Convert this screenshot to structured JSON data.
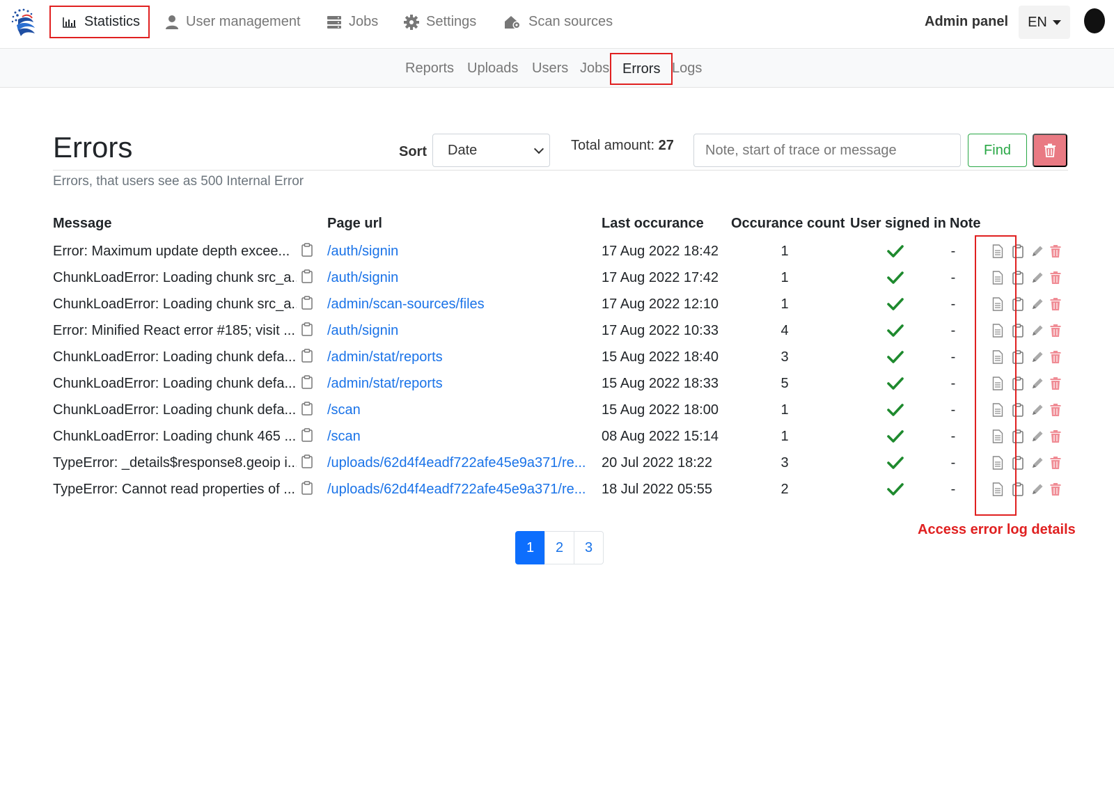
{
  "topnav": {
    "items": [
      {
        "label": "Statistics",
        "icon": "bar-chart-icon",
        "active": true
      },
      {
        "label": "User management",
        "icon": "user-icon"
      },
      {
        "label": "Jobs",
        "icon": "server-icon"
      },
      {
        "label": "Settings",
        "icon": "gear-icon"
      },
      {
        "label": "Scan sources",
        "icon": "house-gear-icon"
      }
    ],
    "admin_label": "Admin panel",
    "language": "EN"
  },
  "subnav": {
    "items": [
      {
        "label": "Reports"
      },
      {
        "label": "Uploads"
      },
      {
        "label": "Users"
      },
      {
        "label": "Jobs"
      },
      {
        "label": "Errors",
        "active": true
      },
      {
        "label": "Logs"
      }
    ]
  },
  "page": {
    "title": "Errors",
    "subtitle": "Errors, that users see as 500 Internal Error",
    "sort_label": "Sort",
    "sort_value": "Date",
    "total_label": "Total amount:",
    "total_value": "27",
    "search_placeholder": "Note, start of trace or message",
    "find_label": "Find"
  },
  "table": {
    "headers": {
      "message": "Message",
      "page_url": "Page url",
      "last_occurance": "Last occurance",
      "occurance_count": "Occurance count",
      "user_signed_in": "User signed in",
      "note": "Note"
    },
    "rows": [
      {
        "message": "Error: Maximum update depth excee...",
        "url": "/auth/signin",
        "date": "17 Aug 2022 18:42",
        "count": "1",
        "signed_in": true,
        "note": "-"
      },
      {
        "message": "ChunkLoadError: Loading chunk src_a...",
        "url": "/auth/signin",
        "date": "17 Aug 2022 17:42",
        "count": "1",
        "signed_in": true,
        "note": "-"
      },
      {
        "message": "ChunkLoadError: Loading chunk src_a...",
        "url": "/admin/scan-sources/files",
        "date": "17 Aug 2022 12:10",
        "count": "1",
        "signed_in": true,
        "note": "-"
      },
      {
        "message": "Error: Minified React error #185; visit ...",
        "url": "/auth/signin",
        "date": "17 Aug 2022 10:33",
        "count": "4",
        "signed_in": true,
        "note": "-"
      },
      {
        "message": "ChunkLoadError: Loading chunk defa...",
        "url": "/admin/stat/reports",
        "date": "15 Aug 2022 18:40",
        "count": "3",
        "signed_in": true,
        "note": "-"
      },
      {
        "message": "ChunkLoadError: Loading chunk defa...",
        "url": "/admin/stat/reports",
        "date": "15 Aug 2022 18:33",
        "count": "5",
        "signed_in": true,
        "note": "-"
      },
      {
        "message": "ChunkLoadError: Loading chunk defa...",
        "url": "/scan",
        "date": "15 Aug 2022 18:00",
        "count": "1",
        "signed_in": true,
        "note": "-"
      },
      {
        "message": "ChunkLoadError: Loading chunk 465 ...",
        "url": "/scan",
        "date": "08 Aug 2022 15:14",
        "count": "1",
        "signed_in": true,
        "note": "-"
      },
      {
        "message": "TypeError: _details$response8.geoip i...",
        "url": "/uploads/62d4f4eadf722afe45e9a371/re...",
        "date": "20 Jul 2022 18:22",
        "count": "3",
        "signed_in": true,
        "note": "-"
      },
      {
        "message": "TypeError: Cannot read properties of ...",
        "url": "/uploads/62d4f4eadf722afe45e9a371/re...",
        "date": "18 Jul 2022 05:55",
        "count": "2",
        "signed_in": true,
        "note": "-"
      }
    ]
  },
  "annotation": "Access error log details",
  "pagination": {
    "pages": [
      "1",
      "2",
      "3"
    ],
    "current": "1"
  },
  "colors": {
    "accent": "#0d6efd",
    "link": "#1a73e8",
    "success": "#28a745",
    "danger": "#e97a83",
    "check": "#1e8a2e",
    "highlight": "#e02020"
  }
}
